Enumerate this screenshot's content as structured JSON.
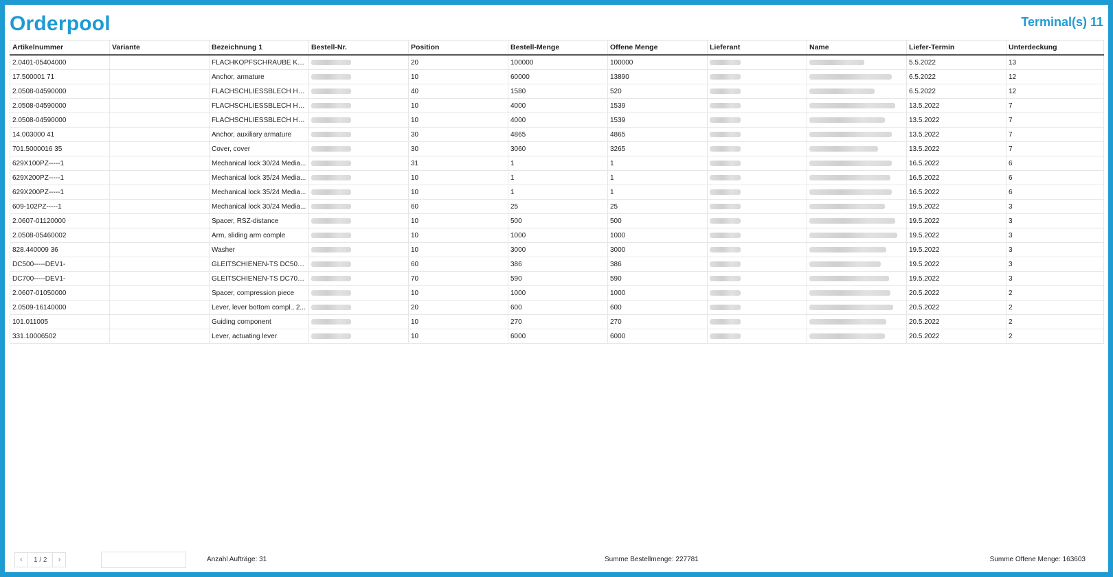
{
  "header": {
    "title": "Orderpool",
    "terminal": "Terminal(s) 11"
  },
  "columns": [
    "Artikelnummer",
    "Variante",
    "Bezeichnung 1",
    "Bestell-Nr.",
    "Position",
    "Bestell-Menge",
    "Offene Menge",
    "Lieferant",
    "Name",
    "Liefer-Termin",
    "Unterdeckung"
  ],
  "rows": [
    {
      "artikel": "2.0401-05404000",
      "variante": "",
      "bezeichnung": "FLACHKOPFSCHRAUBE Kom...",
      "position": "20",
      "bestell_menge": "100000",
      "offene_menge": "100000",
      "termin": "5.5.2022",
      "unterdeckung": "13"
    },
    {
      "artikel": "17.500001 71",
      "variante": "",
      "bezeichnung": "Anchor, armature",
      "position": "10",
      "bestell_menge": "60000",
      "offene_menge": "13890",
      "termin": "6.5.2022",
      "unterdeckung": "12"
    },
    {
      "artikel": "2.0508-04590000",
      "variante": "",
      "bezeichnung": "FLACHSCHLIESSBLECH HZ. E...",
      "position": "40",
      "bestell_menge": "1580",
      "offene_menge": "520",
      "termin": "6.5.2022",
      "unterdeckung": "12"
    },
    {
      "artikel": "2.0508-04590000",
      "variante": "",
      "bezeichnung": "FLACHSCHLIESSBLECH HZ. E...",
      "position": "10",
      "bestell_menge": "4000",
      "offene_menge": "1539",
      "termin": "13.5.2022",
      "unterdeckung": "7"
    },
    {
      "artikel": "2.0508-04590000",
      "variante": "",
      "bezeichnung": "FLACHSCHLIESSBLECH HZ. E...",
      "position": "10",
      "bestell_menge": "4000",
      "offene_menge": "1539",
      "termin": "13.5.2022",
      "unterdeckung": "7"
    },
    {
      "artikel": "14.003000 41",
      "variante": "",
      "bezeichnung": "Anchor, auxiliary armature",
      "position": "30",
      "bestell_menge": "4865",
      "offene_menge": "4865",
      "termin": "13.5.2022",
      "unterdeckung": "7"
    },
    {
      "artikel": "701.5000016 35",
      "variante": "",
      "bezeichnung": "Cover, cover",
      "position": "30",
      "bestell_menge": "3060",
      "offene_menge": "3265",
      "termin": "13.5.2022",
      "unterdeckung": "7"
    },
    {
      "artikel": "629X100PZ-----1",
      "variante": "",
      "bezeichnung": "Mechanical lock 30/24 Media...",
      "position": "31",
      "bestell_menge": "1",
      "offene_menge": "1",
      "termin": "16.5.2022",
      "unterdeckung": "6"
    },
    {
      "artikel": "629X200PZ-----1",
      "variante": "",
      "bezeichnung": "Mechanical lock 35/24 Media...",
      "position": "10",
      "bestell_menge": "1",
      "offene_menge": "1",
      "termin": "16.5.2022",
      "unterdeckung": "6"
    },
    {
      "artikel": "629X200PZ-----1",
      "variante": "",
      "bezeichnung": "Mechanical lock 35/24 Media...",
      "position": "10",
      "bestell_menge": "1",
      "offene_menge": "1",
      "termin": "16.5.2022",
      "unterdeckung": "6"
    },
    {
      "artikel": "609-102PZ-----1",
      "variante": "",
      "bezeichnung": "Mechanical lock 30/24 Media...",
      "position": "60",
      "bestell_menge": "25",
      "offene_menge": "25",
      "termin": "19.5.2022",
      "unterdeckung": "3"
    },
    {
      "artikel": "2.0607-01120000",
      "variante": "",
      "bezeichnung": "Spacer, RSZ-distance",
      "position": "10",
      "bestell_menge": "500",
      "offene_menge": "500",
      "termin": "19.5.2022",
      "unterdeckung": "3"
    },
    {
      "artikel": "2.0508-05460002",
      "variante": "",
      "bezeichnung": "Arm, sliding arm comple",
      "position": "10",
      "bestell_menge": "1000",
      "offene_menge": "1000",
      "termin": "19.5.2022",
      "unterdeckung": "3"
    },
    {
      "artikel": "828.440009 36",
      "variante": "",
      "bezeichnung": "Washer",
      "position": "10",
      "bestell_menge": "3000",
      "offene_menge": "3000",
      "termin": "19.5.2022",
      "unterdeckung": "3"
    },
    {
      "artikel": "DC500-----DEV1-",
      "variante": "",
      "bezeichnung": "GLEITSCHIENEN-TS DC500 A...",
      "position": "60",
      "bestell_menge": "386",
      "offene_menge": "386",
      "termin": "19.5.2022",
      "unterdeckung": "3"
    },
    {
      "artikel": "DC700-----DEV1-",
      "variante": "",
      "bezeichnung": "GLEITSCHIENEN-TS DC700 A...",
      "position": "70",
      "bestell_menge": "590",
      "offene_menge": "590",
      "termin": "19.5.2022",
      "unterdeckung": "3"
    },
    {
      "artikel": "2.0607-01050000",
      "variante": "",
      "bezeichnung": "Spacer, compression piece",
      "position": "10",
      "bestell_menge": "1000",
      "offene_menge": "1000",
      "termin": "20.5.2022",
      "unterdeckung": "2"
    },
    {
      "artikel": "2.0509-16140000",
      "variante": "",
      "bezeichnung": "Lever, lever bottom compl., 2...",
      "position": "20",
      "bestell_menge": "600",
      "offene_menge": "600",
      "termin": "20.5.2022",
      "unterdeckung": "2"
    },
    {
      "artikel": "101.011005",
      "variante": "",
      "bezeichnung": "Guiding component",
      "position": "10",
      "bestell_menge": "270",
      "offene_menge": "270",
      "termin": "20.5.2022",
      "unterdeckung": "2"
    },
    {
      "artikel": "331.10006502",
      "variante": "",
      "bezeichnung": "Lever, actuating lever",
      "position": "10",
      "bestell_menge": "6000",
      "offene_menge": "6000",
      "termin": "20.5.2022",
      "unterdeckung": "2"
    }
  ],
  "footer": {
    "prev": "‹",
    "page_info": "1 / 2",
    "next": "›",
    "anzahl": "Anzahl Aufträge: 31",
    "summe_bestell": "Summe Bestellmenge: 227781",
    "summe_offen": "Summe Offene Menge: 163603"
  }
}
